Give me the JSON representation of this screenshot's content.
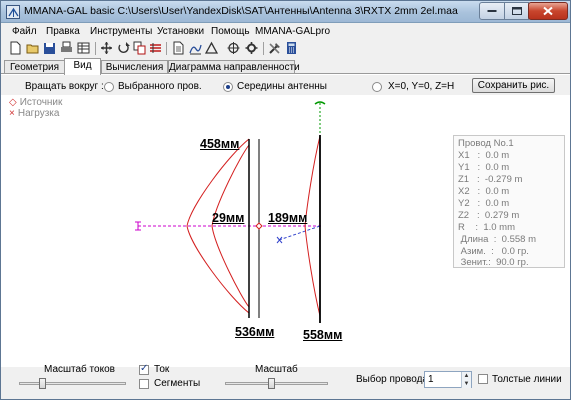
{
  "window": {
    "title": "MMANA-GAL basic C:\\Users\\User\\YandexDisk\\SAT\\Антенны\\Antenna 3\\RXTX 2mm 2el.maa"
  },
  "menu": [
    "Файл",
    "Правка",
    "Инструменты",
    "Установки",
    "Помощь",
    "MMANA-GALpro"
  ],
  "toolbar_icons": [
    "new-file-icon",
    "open-folder-icon",
    "save-icon",
    "print-icon",
    "table-icon",
    "move-icon",
    "rotate-icon",
    "copy-icon",
    "wires-icon",
    "document-icon",
    "ruler-icon",
    "triangle-icon",
    "target-icon",
    "settings-icon",
    "tools-icon",
    "calculator-icon"
  ],
  "tabs": [
    {
      "label": "Геометрия",
      "active": false
    },
    {
      "label": "Вид",
      "active": true
    },
    {
      "label": "Вычисления",
      "active": false
    },
    {
      "label": "Диаграмма направленности",
      "active": false
    }
  ],
  "rotate": {
    "label": "Вращать вокруг :",
    "options": [
      {
        "label": "Выбранного пров.",
        "checked": false
      },
      {
        "label": "Середины антенны",
        "checked": true
      },
      {
        "label": "X=0, Y=0, Z=H",
        "checked": false
      }
    ],
    "save_button": "Сохранить рис."
  },
  "legend": {
    "source_marker": "◇",
    "source": "Источник",
    "load_marker": "×",
    "load": "Нагрузка"
  },
  "annotations": {
    "top_left": "458мм",
    "spacing_small": "29мм",
    "spacing_large": "189мм",
    "bottom_left": "536мм",
    "bottom_right": "558мм"
  },
  "wire_info": [
    "Провод No.1",
    "X1   :  0.0 m",
    "Y1   :  0.0 m",
    "Z1   :  -0.279 m",
    "X2   :  0.0 m",
    "Y2   :  0.0 m",
    "Z2   :  0.279 m",
    "R    :  1.0 mm",
    " Длина  :  0.558 m",
    " Азим.  :   0.0 гр.",
    " Зенит.:  90.0 гр."
  ],
  "bottom": {
    "current_scale_label": "Масштаб токов",
    "current_scale_level": 0.2,
    "current_checkbox": {
      "label": "Ток",
      "checked": true
    },
    "segments_checkbox": {
      "label": "Сегменты",
      "checked": false
    },
    "scale_label": "Масштаб",
    "scale_level": 0.45,
    "wire_select_label": "Выбор провода",
    "wire_select_value": "1",
    "thick_lines_checkbox": {
      "label": "Толстые линии",
      "checked": false
    }
  },
  "colors": {
    "current_curve": "#d42020",
    "wire": "#000000",
    "axis": "#cc00cc",
    "z_axis": "#009900",
    "accent": "#1d3f8a"
  }
}
